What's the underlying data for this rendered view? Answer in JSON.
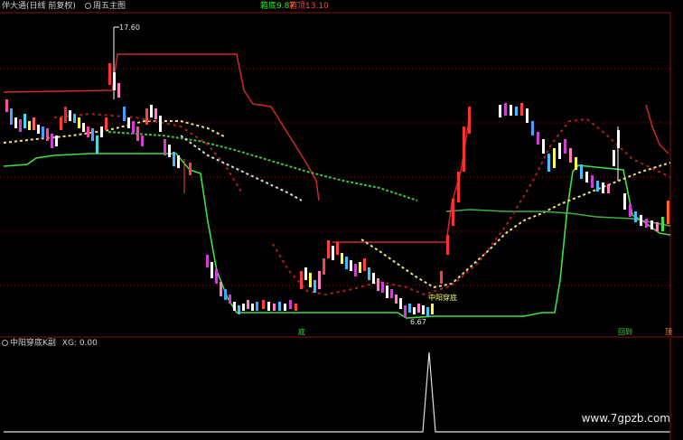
{
  "header": {
    "title": "伴大通(日线 前复权)",
    "indicator": "周五主图",
    "stat1_label": "箱底:",
    "stat1_value": "9.87",
    "stat2_label": "箱顶:",
    "stat2_value": "13.10"
  },
  "chart": {
    "high_label": "17.60",
    "low_label": "6.67",
    "signal_label": "中阳穿底"
  },
  "sub_panel": {
    "title": "中阳穿底K副",
    "value": "XG: 0.00"
  },
  "markers": {
    "m1": "底",
    "m2": "回到",
    "m3": "顶"
  },
  "watermark": "www.7gpzb.com",
  "colors": {
    "background": "#000000",
    "grid": "#8a1010",
    "box_line": "#e03030",
    "support_line": "#40e040",
    "ma_yellow": "#f0e090",
    "ma_green": "#40c040"
  }
}
